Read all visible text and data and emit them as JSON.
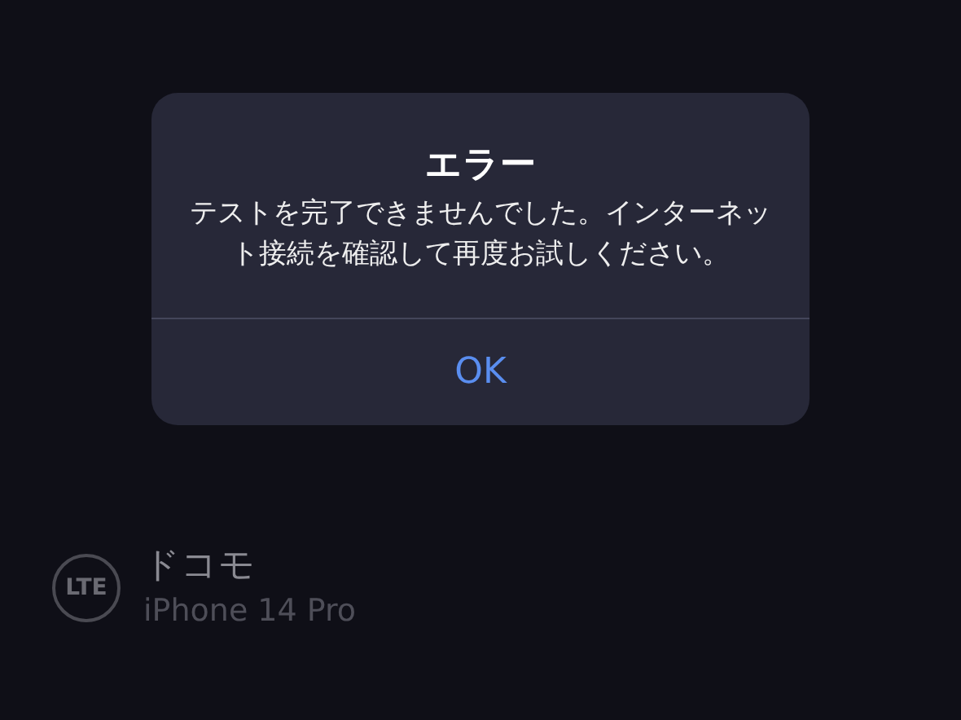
{
  "alert": {
    "title": "エラー",
    "message": "テストを完了できませんでした。インターネット接続を確認して再度お試しください。",
    "buttons": [
      "OK"
    ]
  },
  "carrier": {
    "badge": "LTE",
    "name": "ドコモ",
    "device": "iPhone 14 Pro"
  }
}
